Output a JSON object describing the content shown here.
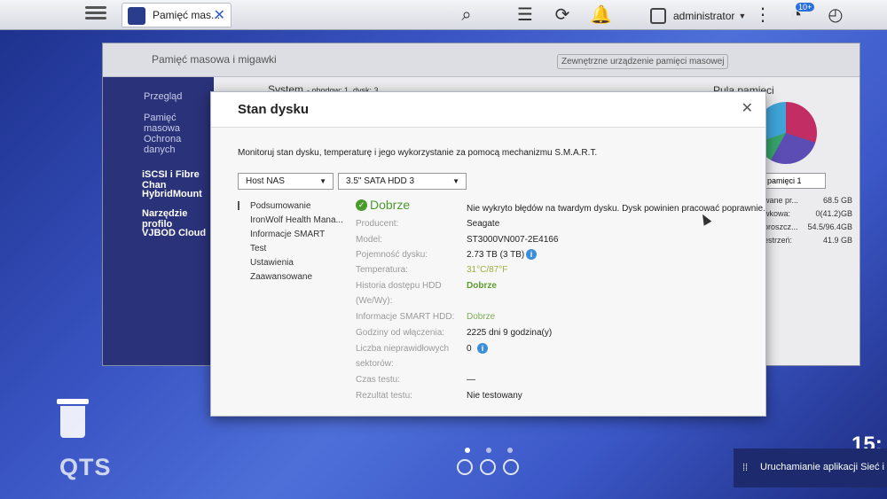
{
  "topbar": {
    "tab_label": "Pamięć mas...",
    "user_name": "administrator",
    "badge": "10+"
  },
  "background_window": {
    "title": "Pamięć masowa i migawki",
    "external_button": "Zewnętrzne urządzenie pamięci masowej",
    "system_label": "System",
    "system_sub": "- obodow: 1, dysk: 3",
    "pool_label": "Pula pamięci",
    "pool_select": "pamięci 1",
    "nav": [
      "Przegląd",
      "Pamięć masowa",
      "Ochrona danych",
      "iSCSI i Fibre Chan",
      "HybridMount",
      "Narzędzie profilo",
      "VJBOD Cloud"
    ],
    "stats": [
      {
        "label": "wane pr...",
        "value": "68.5 GB"
      },
      {
        "label": "wkowa:",
        "value": "0(41.2)GB"
      },
      {
        "label": "proszcz...",
        "value": "54.5/96.4GB"
      },
      {
        "label": "estrzeń:",
        "value": "41.9 GB"
      }
    ]
  },
  "dialog": {
    "title": "Stan dysku",
    "description": "Monitoruj stan dysku, temperaturę i jego wykorzystanie za pomocą mechanizmu S.M.A.R.T.",
    "host_select": "Host NAS",
    "disk_select": "3.5\" SATA HDD 3",
    "nav": [
      "Podsumowanie",
      "IronWolf Health Mana...",
      "Informacje SMART",
      "Test",
      "Ustawienia",
      "Zaawansowane"
    ],
    "status_text": "Dobrze",
    "status_message": "Nie wykryto błędów na twardym dysku. Dysk powinien pracować poprawnie.",
    "fields": {
      "manufacturer_label": "Producent:",
      "manufacturer": "Seagate",
      "model_label": "Model:",
      "model": "ST3000VN007-2E4166",
      "capacity_label": "Pojemność dysku:",
      "capacity": "2.73 TB (3 TB)",
      "temp_label": "Temperatura:",
      "temp": "31°C/87°F",
      "history_label_1": "Historia dostępu HDD",
      "history_label_2": "(We/Wy):",
      "history": "Dobrze",
      "smart_label": "Informacje SMART HDD:",
      "smart": "Dobrze",
      "hours_label": "Godziny od włączenia:",
      "hours": "2225 dni 9 godzina(y)",
      "bad_label_1": "Liczba nieprawidłowych",
      "bad_label_2": "sektorów:",
      "bad": "0",
      "test_time_label": "Czas testu:",
      "test_time": "—",
      "test_result_label": "Rezultat testu:",
      "test_result": "Nie testowany"
    }
  },
  "desktop": {
    "logo": "QTS",
    "clock": "15:",
    "notification": "Uruchamianie aplikacji Sieć i p"
  }
}
